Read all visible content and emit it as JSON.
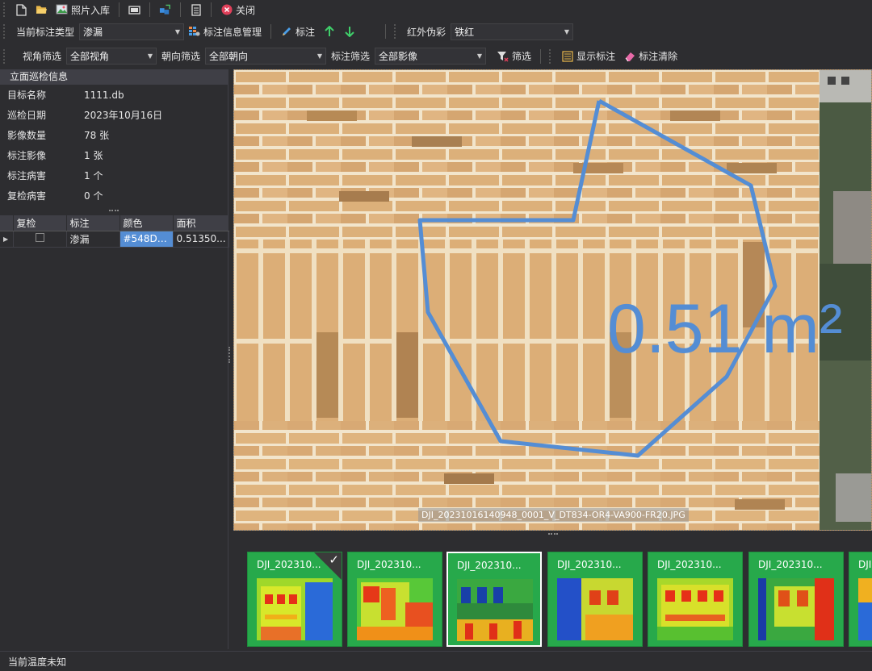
{
  "toolbar1": {
    "items": [
      {
        "icon": "new-file-icon",
        "label": ""
      },
      {
        "icon": "open-folder-icon",
        "label": ""
      },
      {
        "icon": "photo-import-icon",
        "label": "照片入库"
      },
      {
        "icon": "film-icon",
        "label": ""
      },
      {
        "icon": "cube-export-icon",
        "label": ""
      },
      {
        "icon": "document-icon",
        "label": ""
      },
      {
        "icon": "close-circle-icon",
        "label": "关闭"
      }
    ]
  },
  "toolbar2": {
    "annotation_type_label": "当前标注类型",
    "annotation_type_value": "渗漏",
    "manage_label": "标注信息管理",
    "annotate_label": "标注",
    "infrared_label": "红外伪彩",
    "infrared_value": "铁红"
  },
  "toolbar3": {
    "angle_filter_label": "视角筛选",
    "angle_filter_value": "全部视角",
    "orientation_filter_label": "朝向筛选",
    "orientation_filter_value": "全部朝向",
    "annotation_filter_label": "标注筛选",
    "annotation_filter_value": "全部影像",
    "filter_button_label": "筛选",
    "show_annotation_label": "显示标注",
    "clear_annotation_label": "标注清除"
  },
  "info_panel": {
    "title": "立面巡检信息",
    "rows": [
      {
        "key": "目标名称",
        "value": "1111.db"
      },
      {
        "key": "巡检日期",
        "value": "2023年10月16日"
      },
      {
        "key": "影像数量",
        "value": "78 张"
      },
      {
        "key": "标注影像",
        "value": "1 张"
      },
      {
        "key": "标注病害",
        "value": "1 个"
      },
      {
        "key": "复检病害",
        "value": "0 个"
      }
    ]
  },
  "grid": {
    "headers": [
      "复检",
      "标注",
      "颜色",
      "面积"
    ],
    "rows": [
      {
        "recheck": false,
        "type": "渗漏",
        "color": "#548DD...",
        "area": "0.51350..."
      }
    ]
  },
  "viewer": {
    "overlay_text": "0.51 m²",
    "filename": "DJI_20231016140948_0001_V_DT834-OR4-VA900-FR20.JPG",
    "polygon_color": "#548DD4"
  },
  "thumbnails": [
    {
      "label": "DJI_202310...",
      "checked": true,
      "selected": false
    },
    {
      "label": "DJI_202310...",
      "checked": false,
      "selected": false
    },
    {
      "label": "DJI_202310...",
      "checked": false,
      "selected": true
    },
    {
      "label": "DJI_202310...",
      "checked": false,
      "selected": false
    },
    {
      "label": "DJI_202310...",
      "checked": false,
      "selected": false
    },
    {
      "label": "DJI_202310...",
      "checked": false,
      "selected": false
    },
    {
      "label": "DJI",
      "checked": false,
      "selected": false
    }
  ],
  "status": {
    "text": "当前温度未知"
  }
}
